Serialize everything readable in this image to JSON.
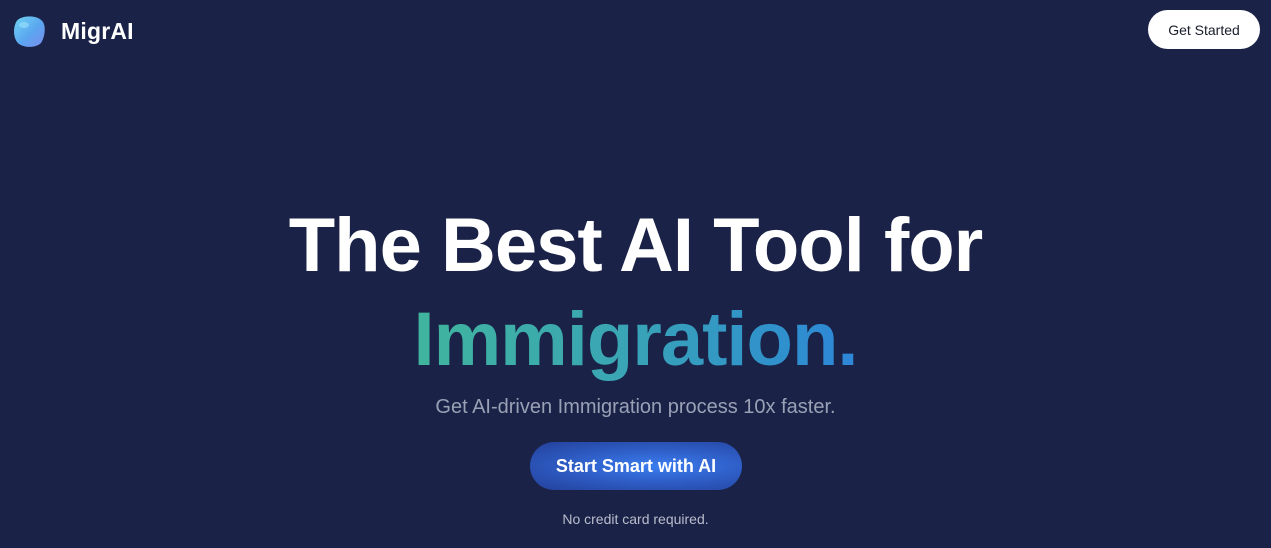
{
  "header": {
    "brand_name": "MigrAI",
    "logo_icon": "blob-logo-icon",
    "get_started_label": "Get Started"
  },
  "hero": {
    "title_line1": "The Best AI Tool for",
    "title_line2": "Immigration.",
    "subtitle": "Get AI-driven Immigration process 10x faster.",
    "cta_label": "Start Smart with AI",
    "note": "No credit card required."
  },
  "colors": {
    "background": "#1a2347",
    "accent_start": "#40b59d",
    "accent_end": "#2e86d8",
    "cta": "#2f5fc8"
  }
}
